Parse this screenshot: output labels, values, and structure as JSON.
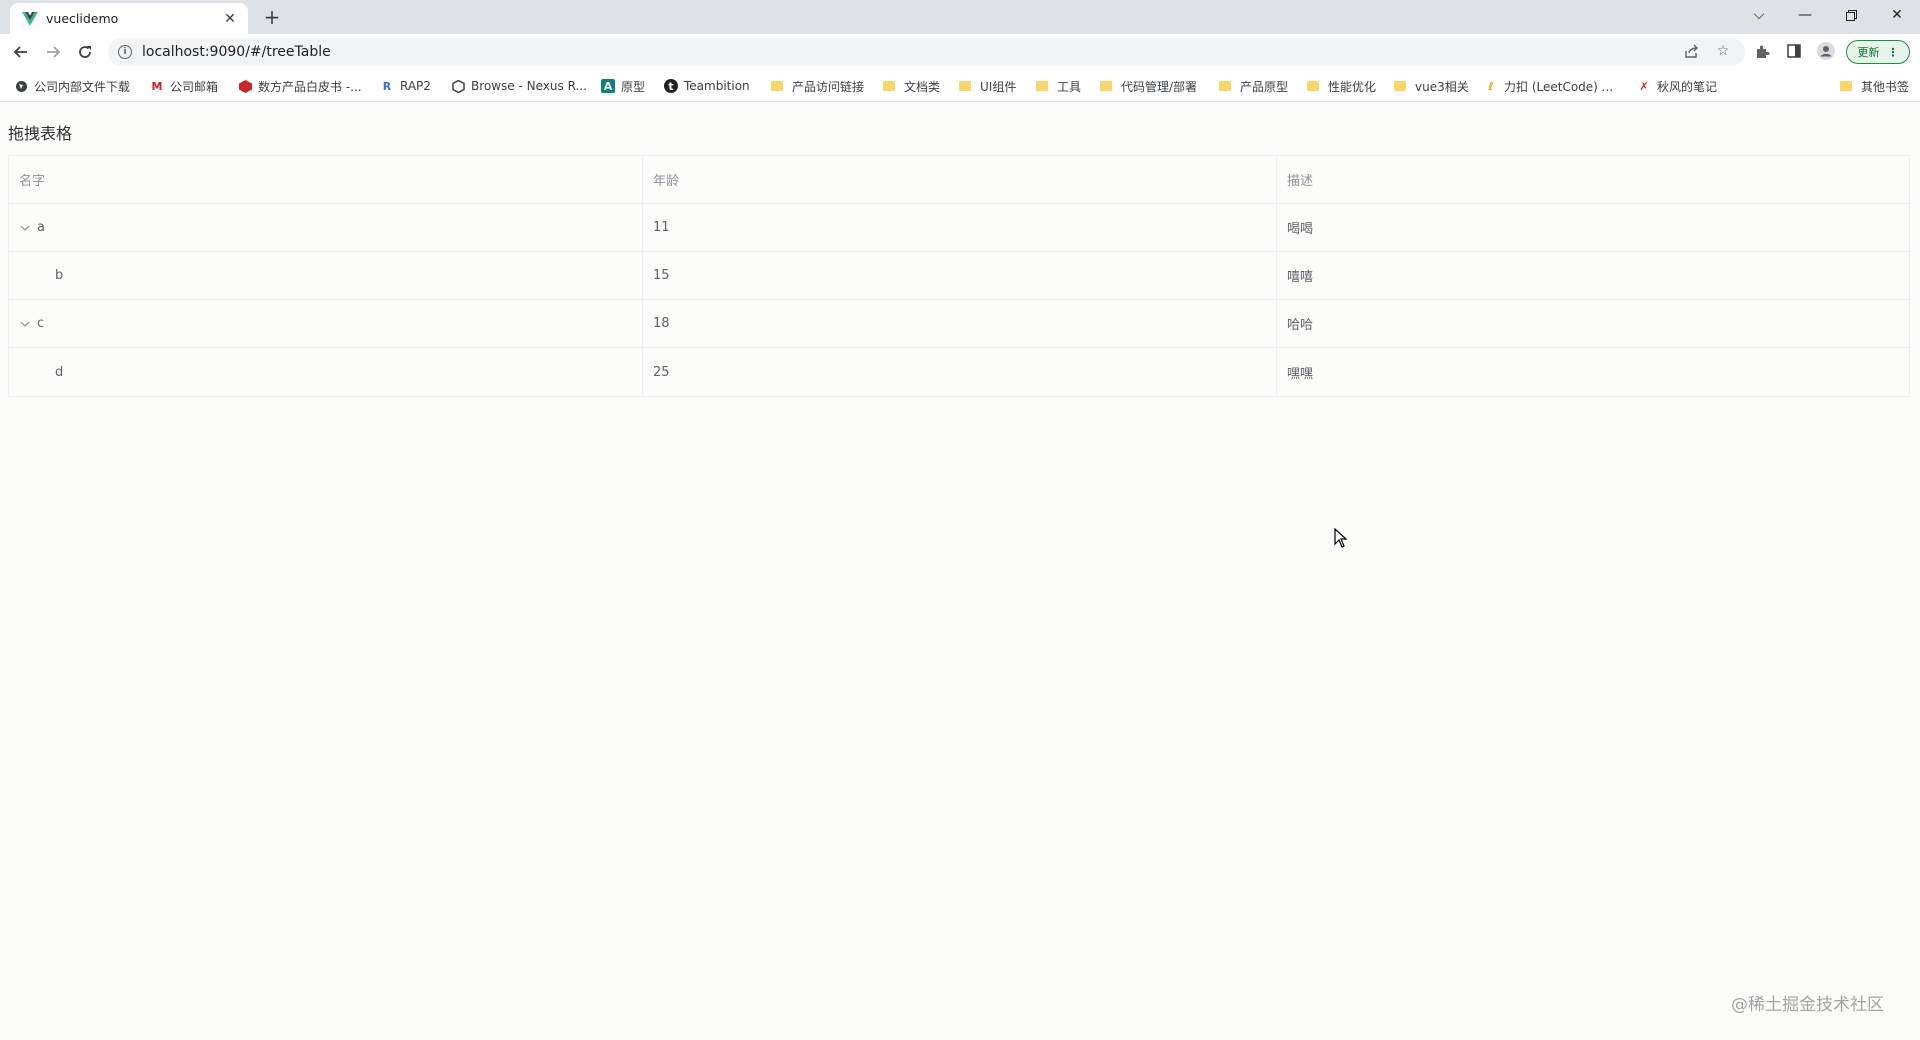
{
  "browser": {
    "tab_title": "vueclidemo",
    "url": "localhost:9090/#/treeTable",
    "update_label": "更新",
    "colors": {
      "tabstrip": "#dee1e6",
      "vue_green": "#42b883",
      "folder": "#f9d66c"
    },
    "bookmarks": [
      {
        "label": "公司内部文件下载",
        "icon": "globe-icon"
      },
      {
        "label": "公司邮箱",
        "icon": "gmail-icon"
      },
      {
        "label": "数方产品白皮书 -...",
        "icon": "red-logo-icon"
      },
      {
        "label": "RAP2",
        "icon": "rap-icon"
      },
      {
        "label": "Browse - Nexus R...",
        "icon": "nexus-icon"
      },
      {
        "label": "原型",
        "icon": "axure-icon"
      },
      {
        "label": "Teambition",
        "icon": "teambition-icon"
      },
      {
        "label": "产品访问链接",
        "icon": "folder-icon"
      },
      {
        "label": "文档类",
        "icon": "folder-icon"
      },
      {
        "label": "UI组件",
        "icon": "folder-icon"
      },
      {
        "label": "工具",
        "icon": "folder-icon"
      },
      {
        "label": "代码管理/部署",
        "icon": "folder-icon"
      },
      {
        "label": "产品原型",
        "icon": "folder-icon"
      },
      {
        "label": "性能优化",
        "icon": "folder-icon"
      },
      {
        "label": "vue3相关",
        "icon": "folder-icon"
      },
      {
        "label": "力扣 (LeetCode) ...",
        "icon": "leetcode-icon"
      },
      {
        "label": "秋风的笔记",
        "icon": "notes-icon"
      }
    ],
    "other_bookmarks": "其他书签"
  },
  "page": {
    "title": "拖拽表格",
    "table": {
      "headers": [
        "名字",
        "年龄",
        "描述"
      ],
      "rows": [
        {
          "name": "a",
          "age": "11",
          "desc": "喝喝",
          "expanded": true,
          "level": 0
        },
        {
          "name": "b",
          "age": "15",
          "desc": "嘻嘻",
          "level": 1
        },
        {
          "name": "c",
          "age": "18",
          "desc": "哈哈",
          "expanded": true,
          "level": 0
        },
        {
          "name": "d",
          "age": "25",
          "desc": "嘿嘿",
          "level": 1
        }
      ]
    }
  },
  "watermark": "@稀土掘金技术社区"
}
